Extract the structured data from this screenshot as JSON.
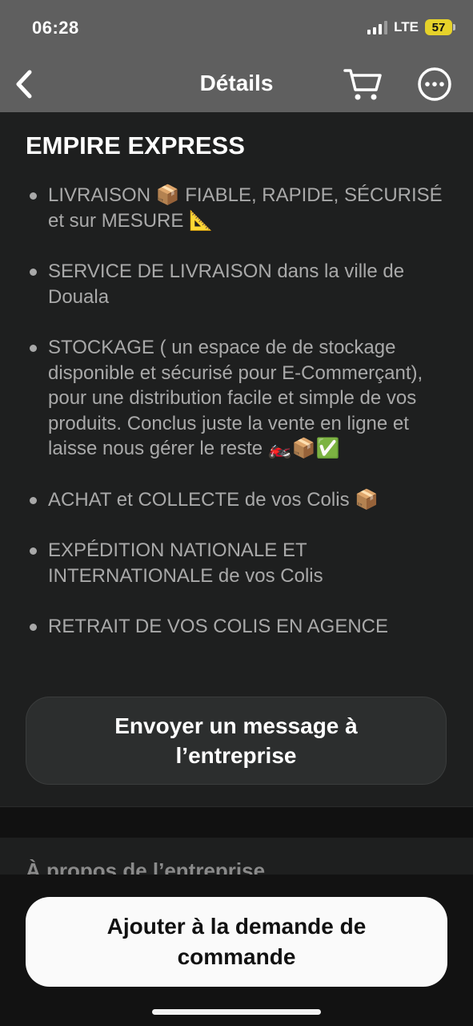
{
  "status_bar": {
    "time": "06:28",
    "network": "LTE",
    "battery": "57",
    "battery_color": "#e6d22a"
  },
  "nav": {
    "title": "Détails",
    "back_icon": "chevron-left-icon",
    "cart_icon": "cart-icon",
    "more_icon": "more-icon"
  },
  "business": {
    "name": "EMPIRE EXPRESS"
  },
  "features": [
    {
      "text": "LIVRAISON 📦 FIABLE, RAPIDE, SÉCURISÉ et sur MESURE 📐"
    },
    {
      "text": "SERVICE DE LIVRAISON dans la ville de Douala"
    },
    {
      "text": "STOCKAGE ( un espace de de stockage disponible et sécurisé pour E-Commerçant), pour une distribution facile et simple de vos produits. Conclus juste la vente en ligne et laisse nous gérer le reste 🏍️📦✅"
    },
    {
      "text": "ACHAT et COLLECTE de vos Colis 📦"
    },
    {
      "text": "EXPÉDITION NATIONALE ET INTERNATIONALE de vos Colis"
    },
    {
      "text": "RETRAIT DE VOS COLIS EN AGENCE"
    }
  ],
  "message_button": {
    "label": "Envoyer un message à l’entreprise"
  },
  "about": {
    "title": "À propos de l’entreprise"
  },
  "order_button": {
    "label": "Ajouter à la demande de commande"
  }
}
